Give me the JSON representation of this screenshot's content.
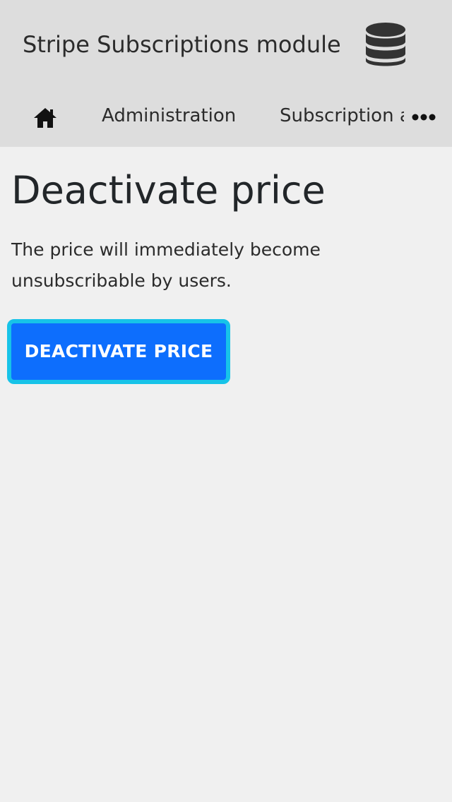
{
  "header": {
    "app_title": "Stripe Subscriptions module",
    "db_icon": "database-icon",
    "background": "#dddddd"
  },
  "nav": {
    "home_icon": "home-icon",
    "items": [
      {
        "label": "Administration"
      },
      {
        "label": "Subscription a"
      }
    ],
    "more_icon": "more-horizontal-icon"
  },
  "main": {
    "title": "Deactivate price",
    "description": "The price will immediately become unsubscribable by users.",
    "button_label": "DEACTIVATE PRICE"
  },
  "colors": {
    "page_background": "#f0f0f0",
    "button_background": "#0d6efd",
    "button_focus_ring": "#17c3e8",
    "button_text": "#ffffff"
  }
}
